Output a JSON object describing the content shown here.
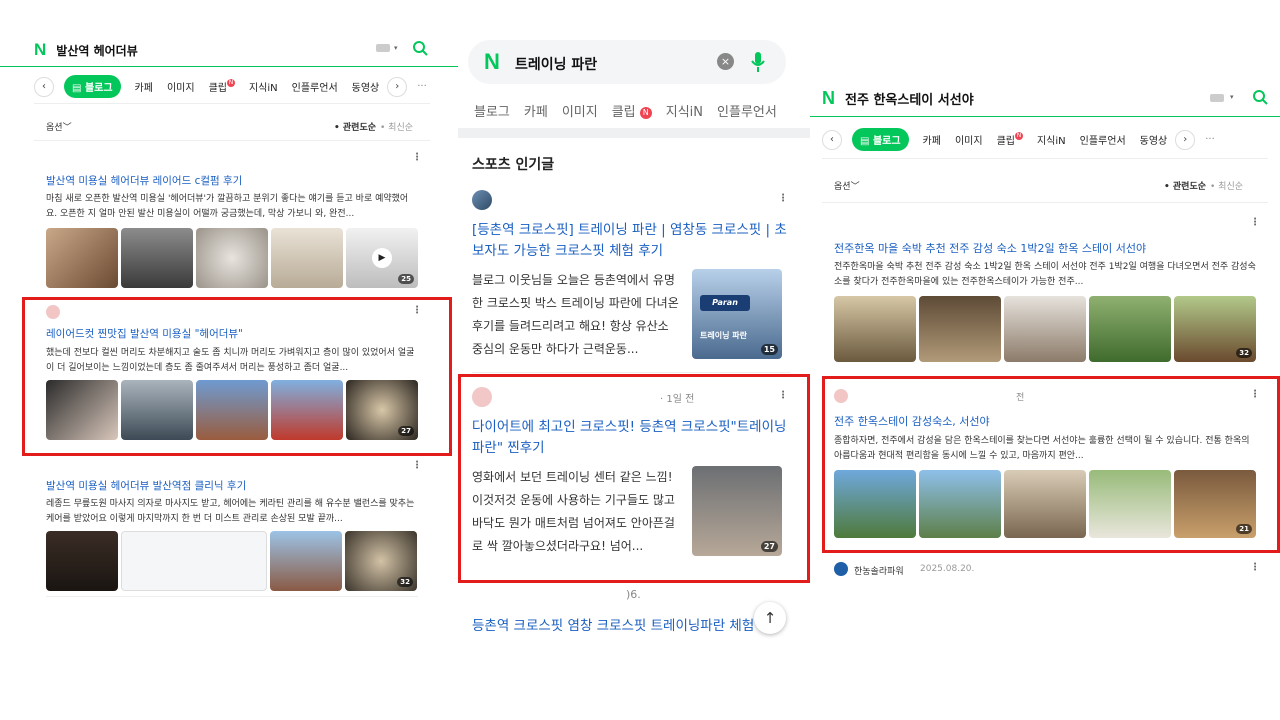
{
  "panel1": {
    "query": "발산역 헤어더뷰",
    "tabs": [
      "블로그",
      "카페",
      "이미지",
      "클립",
      "지식iN",
      "인플루언서",
      "동영상"
    ],
    "clip_badge": "N",
    "sort_option": "옵션",
    "sort_relevance": "• 관련도순",
    "sort_latest": "• 최신순",
    "results": [
      {
        "title": "발산역 미용실 헤어더뷰 레이어드 c컬펌 후기",
        "desc": "마침 새로 오픈한 발산역 미용실 '헤어더뷰'가 깔끔하고 분위기 좋다는 얘기를 듣고 바로 예약했어요. 오픈한 지 얼마 안된 발산 미용실이 어떨까 궁금했는데, 막상 가보니 와, 완전...",
        "count": "25"
      },
      {
        "title": "레이어드컷 찐맛집 발산역 미용실 \"헤어더뷰\"",
        "desc": "했는데 전보다 컬씬 머리도 차분해지고 술도 좀 치니까 머리도 가벼워지고 층이 많이 있었어서 얼굴이 더 길어보이는 느낌이었는데 층도 좀 줄여주셔서 머리는 풍성하고 좀더 얼굴...",
        "count": "27"
      },
      {
        "title": "발산역 미용실 헤어더뷰 발산역점 클리닉 후기",
        "desc": "레종드 무릎도원 마사지 의자로 마사지도 받고, 헤어에는 케라틴 관리를 해 유수분 밸런스를 맞추는 케어를 받았어요 이렇게 마지막까지 한 번 더 미스트 관리로 손상된 모발 끝까...",
        "count": "32"
      }
    ]
  },
  "panel2": {
    "query": "트레이닝 파란",
    "tabs": [
      "블로그",
      "카페",
      "이미지",
      "클립",
      "지식iN",
      "인플루언서"
    ],
    "clip_badge": "N",
    "section_title": "스포츠 인기글",
    "posts": [
      {
        "title": "[등촌역 크로스핏] 트레이닝 파란 | 염창동 크로스핏 | 초보자도 가능한 크로스핏 체험 후기",
        "desc": "블로그 이웃님들 오늘은 등촌역에서 유명한 크로스핏 박스 트레이닝 파란에 다녀온 후기를 들려드리려고 해요! 항상 유산소 중심의 운동만 하다가 근력운동...",
        "count": "15",
        "thumb_text": "트레이닝 파란",
        "sign_text": "Paran"
      },
      {
        "time": "· 1일 전",
        "title": "다이어트에 최고인 크로스핏! 등촌역 크로스핏\"트레이닝파란\" 찐후기",
        "desc": "영화에서 보던 트레이닝 센터 같은 느낌! 이것저것 운동에 사용하는 기구들도 많고 바닥도 뭔가 매트처럼 넘어져도 안아픈걸로 싹 깔아놓으셨더라구요! 넘어...",
        "count": "27"
      },
      {
        "date_partial": ")6.",
        "title": "등촌역 크로스핏 염창 크로스핏 트레이닝파란 체험"
      }
    ],
    "top_arrow": "↑"
  },
  "panel3": {
    "query": "전주 한옥스테이 서선야",
    "tabs": [
      "블로그",
      "카페",
      "이미지",
      "클립",
      "지식iN",
      "인플루언서",
      "동영상"
    ],
    "clip_badge": "N",
    "sort_option": "옵션",
    "sort_relevance": "• 관련도순",
    "sort_latest": "• 최신순",
    "results": [
      {
        "title": "전주한옥 마을 숙박 추천 전주 감성 숙소 1박2일 한옥 스테이 서선야",
        "desc": "전주한옥마을 숙박 추천 전주 감성 숙소 1박2일 한옥 스테이 서선야 전주 1박2일 여행을 다녀오면서 전주 감성숙소를 찾다가 전주한옥마을에 있는 전주한옥스테이가 가능한 전주...",
        "count": "32"
      },
      {
        "time": "전",
        "title": "전주 한옥스테이 감성숙소, 서선야",
        "desc": "종합하자면, 전주에서 감성을 담은 한옥스테이를 찾는다면 서선야는 훌륭한 선택이 될 수 있습니다. 전통 한옥의 아름다움과 현대적 편리함을 동시에 느낄 수 있고, 마음까지 편안...",
        "count": "21"
      }
    ],
    "footer_author": "한농솔라파워",
    "footer_date": "2025.08.20."
  }
}
